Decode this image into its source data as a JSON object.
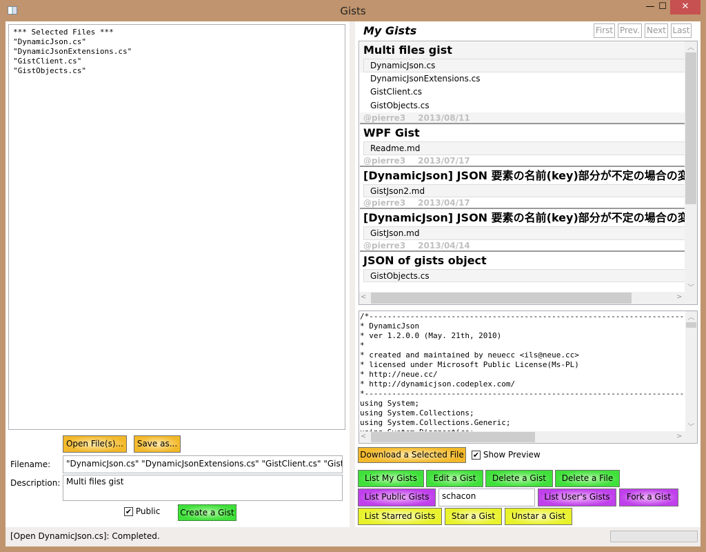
{
  "window": {
    "title": "Gists",
    "minimize": "—",
    "maximize": "☐",
    "close": "✕"
  },
  "left": {
    "selected_text": "*** Selected Files ***\n\"DynamicJson.cs\"\n\"DynamicJsonExtensions.cs\"\n\"GistClient.cs\"\n\"GistObjects.cs\"",
    "open_files": "Open File(s)...",
    "save_as": "Save as...",
    "filename_label": "Filename:",
    "filename_value": "\"DynamicJson.cs\" \"DynamicJsonExtensions.cs\" \"GistClient.cs\" \"GistObjects.cs\"",
    "description_label": "Description:",
    "description_value": "Multi files gist",
    "public_label": "Public",
    "public_checked": true,
    "create_gist": "Create a Gist"
  },
  "status": {
    "text": "[Open DynamicJson.cs]: Completed."
  },
  "right": {
    "heading": "My Gists",
    "paging": {
      "first": "First",
      "prev": "Prev.",
      "next": "Next",
      "last": "Last"
    },
    "gists": [
      {
        "title": "Multi files gist",
        "files": [
          "DynamicJson.cs",
          "DynamicJsonExtensions.cs",
          "GistClient.cs",
          "GistObjects.cs"
        ],
        "user": "@pierre3",
        "date": "2013/08/11"
      },
      {
        "title": "WPF Gist",
        "files": [
          "Readme.md"
        ],
        "user": "@pierre3",
        "date": "2013/07/17"
      },
      {
        "title": "[DynamicJson] JSON 要素の名前(key)部分が不定の場合の変換",
        "files": [
          "GistJson2.md"
        ],
        "user": "@pierre3",
        "date": "2013/04/17"
      },
      {
        "title": "[DynamicJson] JSON 要素の名前(key)部分が不定の場合の変換",
        "files": [
          "GistJson.md"
        ],
        "user": "@pierre3",
        "date": "2013/04/14"
      },
      {
        "title": "JSON of gists object",
        "files": [
          "GistObjects.cs"
        ]
      }
    ],
    "preview": "/*--------------------------------------------------------------------------------\n* DynamicJson\n* ver 1.2.0.0 (May. 21th, 2010)\n*\n* created and maintained by neuecc <ils@neue.cc>\n* licensed under Microsoft Public License(Ms-PL)\n* http://neue.cc/\n* http://dynamicjson.codeplex.com/\n*--------------------------------------------------------------------------------\nusing System;\nusing System.Collections;\nusing System.Collections.Generic;\nusing System.Diagnostics;",
    "download": "Download a Selected File",
    "show_preview": "Show Preview",
    "show_preview_checked": true,
    "buttons": {
      "list_my": "List My Gists",
      "edit": "Edit a Gist",
      "delete_gist": "Delete a Gist",
      "delete_file": "Delete a File",
      "list_public": "List Public Gists",
      "user_value": "schacon",
      "list_user": "List User's Gists",
      "fork": "Fork a Gist",
      "list_starred": "List Starred Gists",
      "star": "Star a Gist",
      "unstar": "Unstar a Gist"
    }
  }
}
